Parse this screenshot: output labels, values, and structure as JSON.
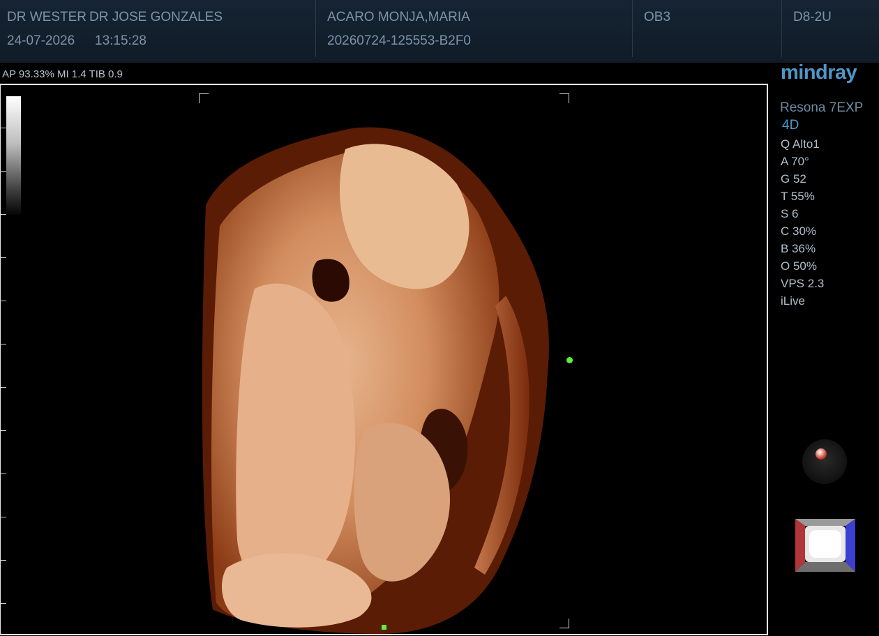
{
  "header": {
    "operator": "DR WESTER",
    "physician": "DR JOSE GONZALES",
    "date": "24-07-2026",
    "time": "13:15:28",
    "patient_name": "ACARO MONJA,MARIA",
    "exam_id": "20260724-125553-B2F0",
    "exam_preset": "OB3",
    "probe": "D8-2U"
  },
  "status_line": "AP 93.33%  MI 1.4 TIB 0.9",
  "panel": {
    "logo": "mindray",
    "model": "Resona 7EXP",
    "mode": "4D",
    "params": [
      "Q Alto1",
      "A 70°",
      "G 52",
      "T 55%",
      "S 6",
      "C 30%",
      "B 36%",
      "O 50%",
      "VPS 2.3",
      "iLive"
    ]
  },
  "icons": {
    "trackball": "trackball-icon",
    "orientation": "orientation-cube-icon"
  },
  "colors": {
    "header_bg": "#162433",
    "text_muted": "#7d93a8",
    "accent_blue": "#4f96c8",
    "marker_green": "#5cf23a"
  }
}
